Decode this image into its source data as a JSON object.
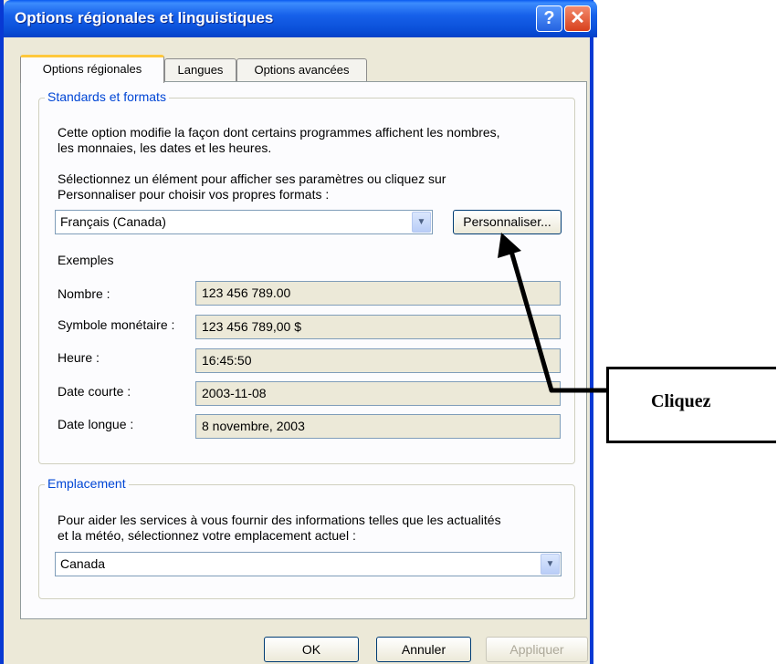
{
  "window": {
    "title": "Options régionales et linguistiques",
    "help_symbol": "?",
    "close_symbol": "✕"
  },
  "tabs": [
    {
      "label": "Options régionales"
    },
    {
      "label": "Langues"
    },
    {
      "label": "Options avancées"
    }
  ],
  "standards": {
    "legend": "Standards et formats",
    "description_line1": "Cette option modifie la façon dont certains programmes affichent les nombres,",
    "description_line2": "les monnaies, les dates et les heures.",
    "select_line1": "Sélectionnez un élément pour afficher ses paramètres ou cliquez sur",
    "select_line2": "Personnaliser pour choisir vos propres formats :",
    "selected_locale": "Français (Canada)",
    "customize_label": "Personnaliser...",
    "examples_label": "Exemples",
    "examples": [
      {
        "label": "Nombre :",
        "value": "123 456 789.00"
      },
      {
        "label": "Symbole monétaire :",
        "value": "123 456 789,00 $"
      },
      {
        "label": "Heure :",
        "value": "16:45:50"
      },
      {
        "label": "Date courte :",
        "value": "2003-11-08"
      },
      {
        "label": "Date longue :",
        "value": "8 novembre, 2003"
      }
    ]
  },
  "location": {
    "legend": "Emplacement",
    "description_line1": "Pour aider les services à vous fournir des informations telles que les actualités",
    "description_line2": "et la météo, sélectionnez votre emplacement actuel :",
    "selected_location": "Canada"
  },
  "buttons": {
    "ok": "OK",
    "cancel": "Annuler",
    "apply": "Appliquer"
  },
  "callout": {
    "text": "Cliquez"
  },
  "colors": {
    "titlebar": "#0a4fd8",
    "legend_text": "#0046d5",
    "window_bg": "#ece9d8"
  }
}
